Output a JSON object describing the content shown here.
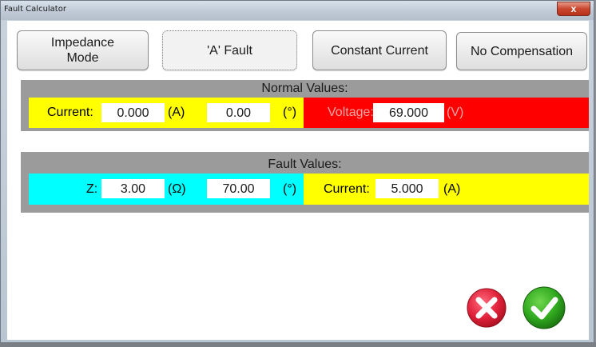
{
  "window": {
    "title": "Fault Calculator",
    "close_label": "x"
  },
  "mode_buttons": [
    {
      "label": "Impedance\nMode",
      "active": false
    },
    {
      "label": "'A' Fault",
      "active": true
    },
    {
      "label": "Constant Current",
      "active": false
    },
    {
      "label": "No Compensation",
      "active": false
    }
  ],
  "normal": {
    "title": "Normal Values:",
    "current_label": "Current:",
    "current_value": "0.000",
    "current_unit": "(A)",
    "angle_value": "0.00",
    "angle_unit": "(°)",
    "voltage_label": "Voltage:",
    "voltage_value": "69.000",
    "voltage_unit": "(V)"
  },
  "fault": {
    "title": "Fault Values:",
    "z_label": "Z:",
    "z_value": "3.00",
    "z_unit": "(Ω)",
    "angle_value": "70.00",
    "angle_unit": "(°)",
    "current_label": "Current:",
    "current_value": "5.000",
    "current_unit": "(A)"
  },
  "colors": {
    "yellow": "#ffff00",
    "red": "#ff0000",
    "cyan": "#00ffff",
    "panel_gray": "#9b9b9b",
    "cancel_red": "#e0213a",
    "ok_green": "#2fa81e"
  },
  "icons": {
    "cancel": "cancel-x-icon",
    "ok": "ok-check-icon"
  }
}
